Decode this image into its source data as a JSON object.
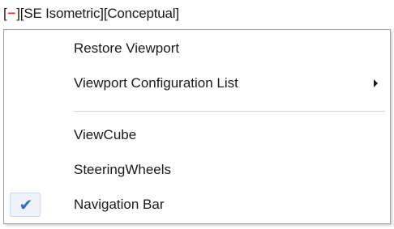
{
  "viewport_label": {
    "open_bracket": "[",
    "minus": "−",
    "close_bracket": "]",
    "view": "[SE Isometric]",
    "visual_style": "[Conceptual]"
  },
  "menu": {
    "items": [
      {
        "label": "Restore Viewport",
        "checked": false,
        "has_submenu": false
      },
      {
        "label": "Viewport Configuration List",
        "checked": false,
        "has_submenu": true
      },
      {
        "label": "ViewCube",
        "checked": false,
        "has_submenu": false
      },
      {
        "label": "SteeringWheels",
        "checked": false,
        "has_submenu": false
      },
      {
        "label": "Navigation Bar",
        "checked": true,
        "has_submenu": false
      }
    ],
    "check_glyph": "✔"
  },
  "colors": {
    "minus_red": "#e8312f",
    "check_blue": "#2e6cc2",
    "text": "#1a1a1a",
    "menu_border": "#a0a0a0"
  }
}
